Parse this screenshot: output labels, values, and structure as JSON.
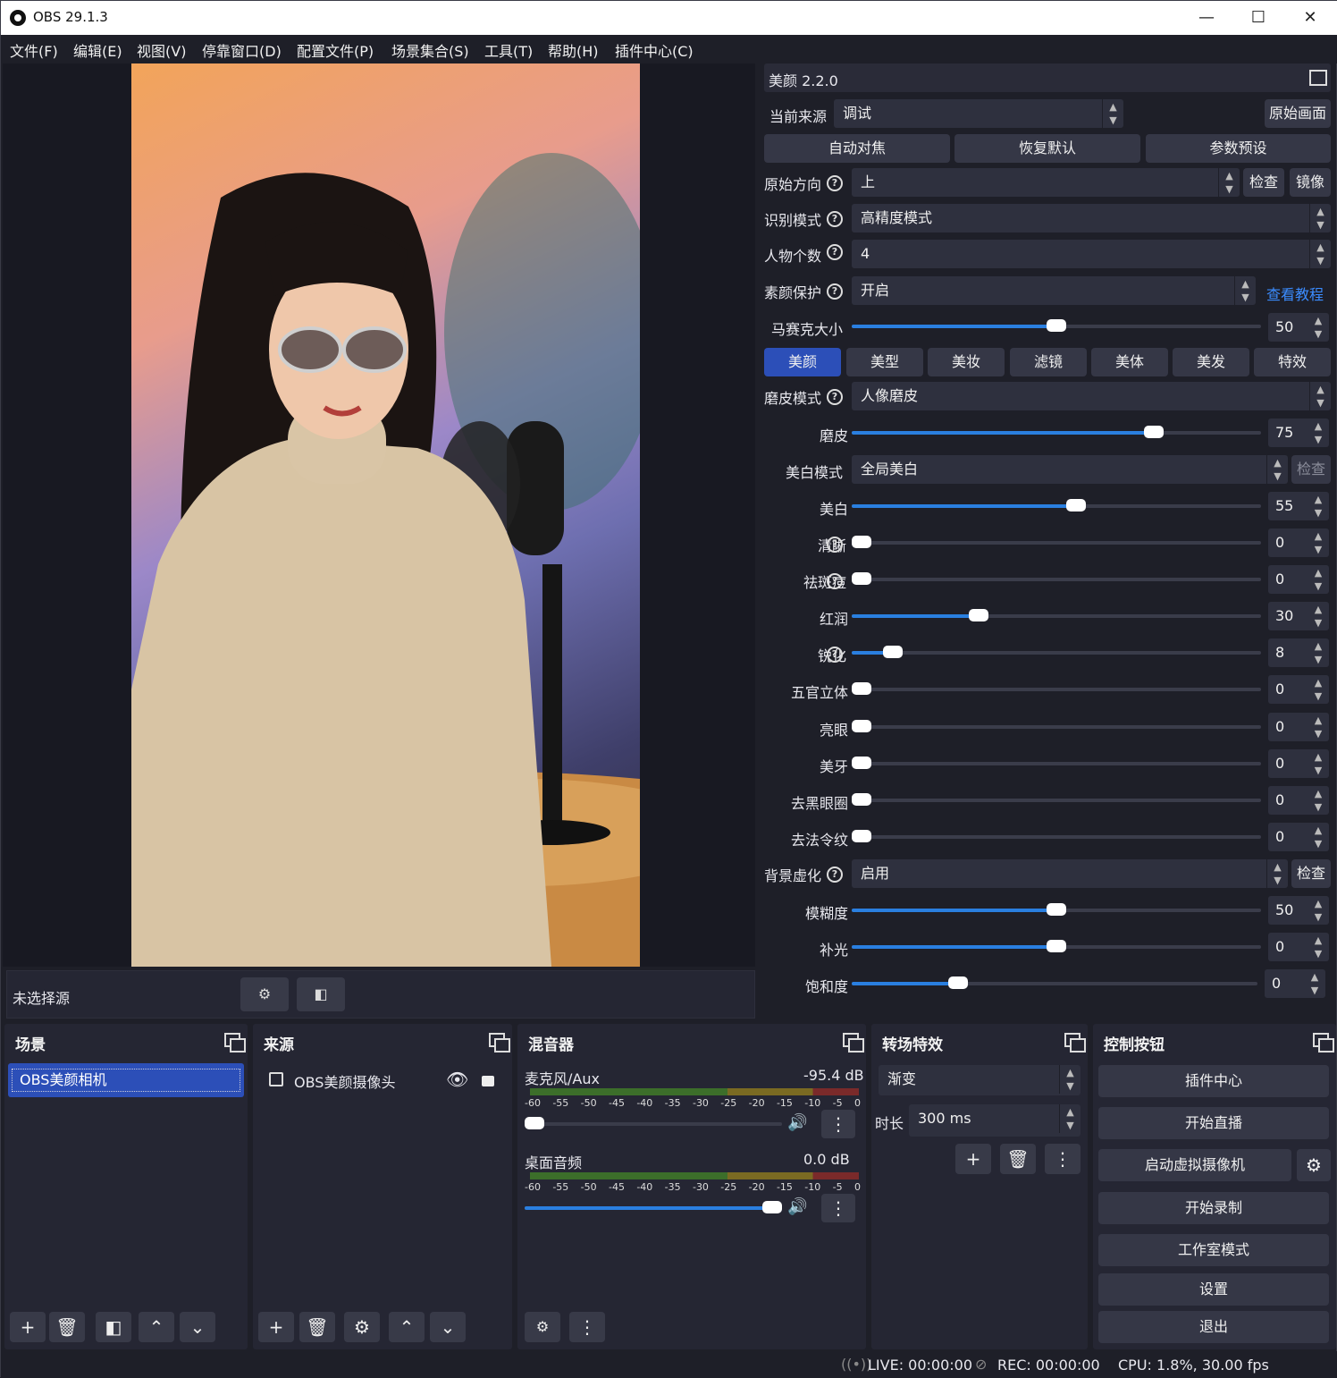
{
  "window": {
    "title": "OBS 29.1.3"
  },
  "menu": [
    "文件(F)",
    "编辑(E)",
    "视图(V)",
    "停靠窗口(D)",
    "配置文件(P)",
    "场景集合(S)",
    "工具(T)",
    "帮助(H)",
    "插件中心(C)"
  ],
  "preview": {
    "no_source_label": "未选择源"
  },
  "filter": {
    "title": "美颜 2.2.0",
    "current_source_label": "当前来源",
    "current_source_value": "调试",
    "original_btn": "原始画面",
    "auto_focus": "自动对焦",
    "restore_default": "恢复默认",
    "param_preset": "参数预设",
    "orientation_label": "原始方向",
    "orientation_value": "上",
    "check": "检查",
    "mirror": "镜像",
    "detect_mode_label": "识别模式",
    "detect_mode_value": "高精度模式",
    "people_count_label": "人物个数",
    "people_count_value": "4",
    "skin_protect_label": "素颜保护",
    "skin_protect_value": "开启",
    "tutorial_link": "查看教程",
    "mosaic_label": "马赛克大小",
    "mosaic_value": "50",
    "tabs": [
      "美颜",
      "美型",
      "美妆",
      "滤镜",
      "美体",
      "美发",
      "特效"
    ],
    "smooth_mode_label": "磨皮模式",
    "smooth_mode_value": "人像磨皮",
    "whiten_mode_label": "美白模式",
    "whiten_mode_value": "全局美白",
    "whiten_check": "检查",
    "sliders": [
      {
        "label": "磨皮",
        "value": "75",
        "level": 0.75
      },
      {
        "label": "美白",
        "value": "55",
        "level": 0.55
      },
      {
        "label": "清晰",
        "value": "0",
        "level": 0
      },
      {
        "label": "祛斑痘",
        "value": "0",
        "level": 0
      },
      {
        "label": "红润",
        "value": "30",
        "level": 0.3
      },
      {
        "label": "锐化",
        "value": "8",
        "level": 0.08
      },
      {
        "label": "五官立体",
        "value": "0",
        "level": 0
      },
      {
        "label": "亮眼",
        "value": "0",
        "level": 0
      },
      {
        "label": "美牙",
        "value": "0",
        "level": 0
      },
      {
        "label": "去黑眼圈",
        "value": "0",
        "level": 0
      },
      {
        "label": "去法令纹",
        "value": "0",
        "level": 0
      }
    ],
    "bg_blur_label": "背景虚化",
    "bg_blur_value": "启用",
    "bg_blur_check": "检查",
    "bg_sliders": [
      {
        "label": "模糊度",
        "value": "50",
        "level": 0.5
      },
      {
        "label": "补光",
        "value": "0",
        "level": 0.5
      },
      {
        "label": "饱和度",
        "value": "0",
        "level": 0.25
      }
    ]
  },
  "docks": {
    "scenes": {
      "title": "场景",
      "items": [
        "OBS美颜相机"
      ]
    },
    "sources": {
      "title": "来源",
      "items": [
        "OBS美颜摄像头"
      ]
    },
    "mixer": {
      "title": "混音器",
      "ticks": [
        "-60",
        "-55",
        "-50",
        "-45",
        "-40",
        "-35",
        "-30",
        "-25",
        "-20",
        "-15",
        "-10",
        "-5",
        "0"
      ],
      "channels": [
        {
          "name": "麦克风/Aux",
          "db": "-95.4 dB",
          "volume": 0.0
        },
        {
          "name": "桌面音频",
          "db": "0.0 dB",
          "volume": 1.0
        }
      ]
    },
    "transitions": {
      "title": "转场特效",
      "type": "渐变",
      "duration_label": "时长",
      "duration_value": "300 ms"
    },
    "controls": {
      "title": "控制按钮",
      "buttons": [
        "插件中心",
        "开始直播",
        "启动虚拟摄像机",
        "开始录制",
        "工作室模式",
        "设置",
        "退出"
      ]
    }
  },
  "status": {
    "live": "LIVE: 00:00:00",
    "rec": "REC: 00:00:00",
    "cpu": "CPU: 1.8%, 30.00 fps"
  },
  "colors": {
    "accent": "#2a7fe0",
    "tab_active": "#2c4fb8",
    "link": "#3b8cff"
  }
}
